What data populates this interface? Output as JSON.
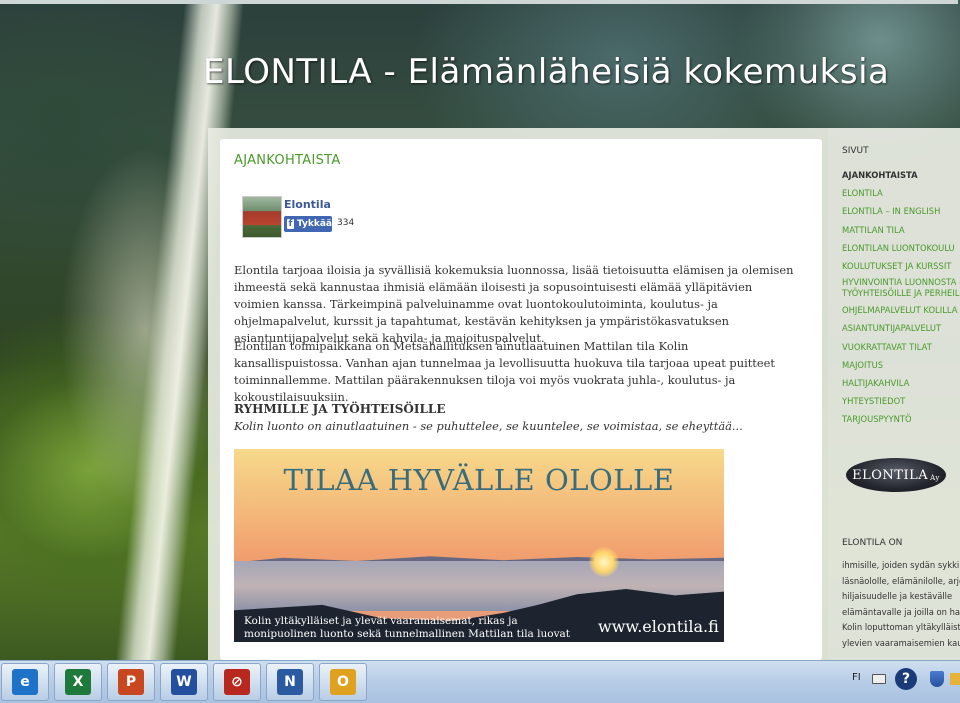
{
  "header": {
    "site_title": "ELONTILA - Elämänläheisiä kokemuksia"
  },
  "main": {
    "section_title": "AJANKOHTAISTA",
    "facebook": {
      "page_name": "Elontila",
      "like_label": "Tykkää",
      "like_count": "334"
    },
    "paragraph1": "Elontila tarjoaa iloisia ja syvällisiä kokemuksia luonnossa, lisää tietoisuutta elämisen ja olemisen ihmeestä sekä kannustaa ihmisiä elämään iloisesti ja sopusointuisesti elämää ylläpitävien voimien kanssa. Tärkeimpinä palveluinamme ovat luontokoulutoiminta, koulutus- ja ohjelmapalvelut, kurssit ja tapahtumat, kestävän kehityksen ja ympäristökasvatuksen asiantuntijapalvelut sekä kahvila- ja majoituspalvelut.",
    "paragraph2": "Elontilan toimipaikkana on Metsähallituksen ainutlaatuinen Mattilan tila Kolin kansallispuistossa. Vanhan ajan tunnelmaa ja levollisuutta huokuva tila tarjoaa upeat puitteet toiminnallemme. Mattilan päärakennuksen tiloja voi myös vuokrata juhla-, koulutus- ja kokoustilaisuuksiin.",
    "subheading": "RYHMILLE JA TYÖHTEISÖILLE",
    "quote": "Kolin luonto on ainutlaatuinen - se puhuttelee, se kuuntelee, se voimistaa, se eheyttää...",
    "banner": {
      "headline": "TILAA HYVÄLLE OLOLLE",
      "caption": "Kolin yltäkylläiset ja ylevät vaaramaisemat, rikas ja monipuolinen luonto sekä tunnelmallinen Mattilan tila luovat ainutlaatuisen",
      "url": "www.elontila.fi"
    }
  },
  "sidebar": {
    "pages_heading": "SIVUT",
    "items": [
      {
        "label": "AJANKOHTAISTA",
        "active": true
      },
      {
        "label": "ELONTILA"
      },
      {
        "label": "ELONTILA – IN ENGLISH"
      },
      {
        "label": "MATTILAN TILA"
      },
      {
        "label": "ELONTILAN LUONTOKOULU"
      },
      {
        "label": "KOULUTUKSET JA KURSSIT"
      },
      {
        "label": "HYVINVOINTIA LUONNOSTA – RY TYÖYHTEISÖILLE JA PERHEILL"
      },
      {
        "label": "OHJELMAPALVELUT KOLILLA"
      },
      {
        "label": "ASIANTUNTIJAPALVELUT"
      },
      {
        "label": "VUOKRATTAVAT TILAT"
      },
      {
        "label": "MAJOITUS"
      },
      {
        "label": "HALTIJAKAHVILA"
      },
      {
        "label": "YHTEYSTIEDOT"
      },
      {
        "label": "TARJOUSPYYNTÖ"
      }
    ],
    "logo_text": "ELONTILA",
    "logo_suffix": "Ay",
    "about_heading": "ELONTILA ON",
    "about_lines": [
      "ihmisille, joiden sydän sykkii",
      "läsnäololle, elämänilolle, arjen",
      "hiljaisuudelle ja kestävälle",
      "elämäntavalle ja joilla on halu",
      "Kolin loputtoman yltäkylläiste",
      "ylevien vaaramaisemien kaune"
    ]
  },
  "taskbar": {
    "apps": [
      {
        "icon": "internet-explorer-icon",
        "glyph": "e",
        "color": "#1e73c8"
      },
      {
        "icon": "excel-icon",
        "glyph": "X",
        "color": "#1d7a3a"
      },
      {
        "icon": "powerpoint-icon",
        "glyph": "P",
        "color": "#c8471f"
      },
      {
        "icon": "word-icon",
        "glyph": "W",
        "color": "#244f9e"
      },
      {
        "icon": "browser-icon",
        "glyph": "⊘",
        "color": "#b8281e"
      },
      {
        "icon": "n-app-icon",
        "glyph": "N",
        "color": "#2a5aa0"
      },
      {
        "icon": "outlook-icon",
        "glyph": "O",
        "color": "#e0a020"
      }
    ],
    "language": "FI"
  }
}
